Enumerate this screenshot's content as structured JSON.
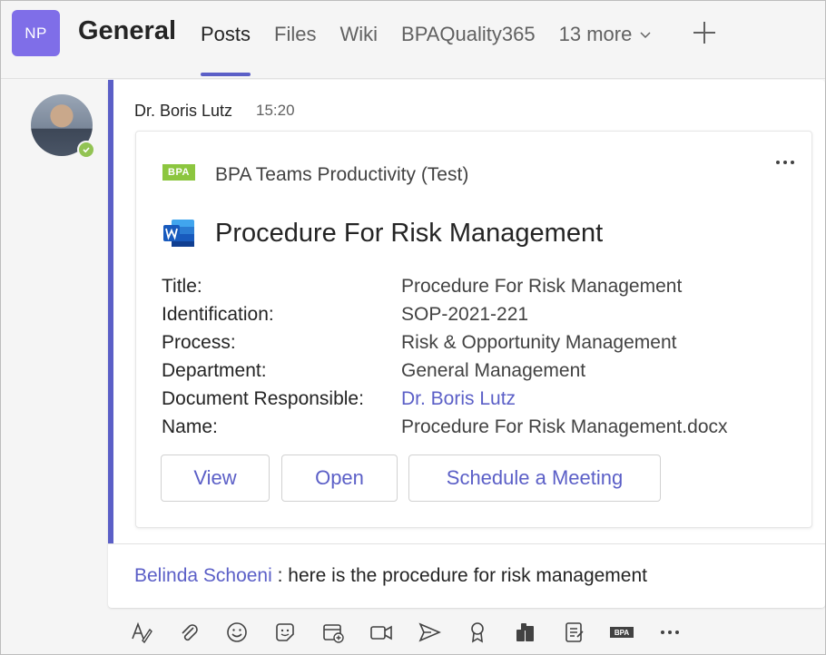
{
  "header": {
    "team_initials": "NP",
    "channel_name": "General",
    "tabs": [
      {
        "label": "Posts",
        "active": true
      },
      {
        "label": "Files"
      },
      {
        "label": "Wiki"
      },
      {
        "label": "BPAQuality365"
      },
      {
        "label": "13 more"
      }
    ]
  },
  "message": {
    "author": "Dr. Boris Lutz",
    "time": "15:20",
    "presence": "available",
    "card": {
      "app_logo_text": "BPA",
      "app_name": "BPA Teams Productivity (Test)",
      "doc_title": "Procedure For Risk Management",
      "fields": [
        {
          "label": "Title:",
          "value": "Procedure For Risk Management"
        },
        {
          "label": "Identification:",
          "value": "SOP-2021-221"
        },
        {
          "label": "Process:",
          "value": "Risk & Opportunity Management"
        },
        {
          "label": "Department:",
          "value": "General Management"
        },
        {
          "label": "Document Responsible:",
          "value": "Dr. Boris Lutz",
          "link": true
        },
        {
          "label": "Name:",
          "value": "Procedure For Risk Management.docx"
        }
      ],
      "buttons": {
        "view": "View",
        "open": "Open",
        "schedule": "Schedule a Meeting"
      }
    },
    "reply": {
      "mention": "Belinda Schoeni",
      "text": " : here is the procedure for risk management"
    }
  },
  "toolbar": {
    "icons": [
      "format-icon",
      "attach-icon",
      "emoji-icon",
      "sticker-icon",
      "schedule-meeting-icon",
      "meet-now-icon",
      "send-icon",
      "praise-icon",
      "apps-icon",
      "forms-icon",
      "bpa-app-icon",
      "more-options-icon"
    ],
    "bpa_label": "BPA"
  },
  "colors": {
    "brand": "#5b5fc7",
    "team_avatar": "#7f6ee8",
    "bpa_green": "#8cc63f",
    "presence_green": "#92c353"
  }
}
